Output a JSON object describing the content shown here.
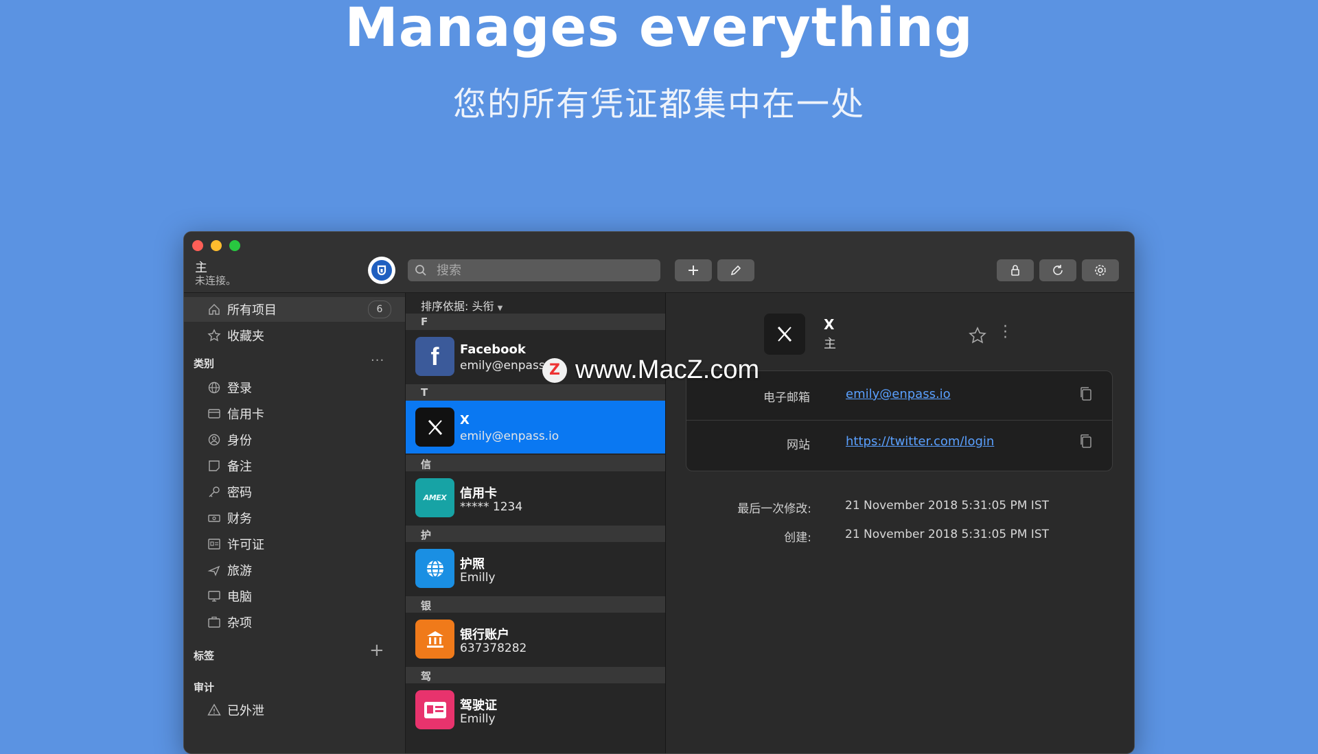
{
  "hero": {
    "title": "Manages everything",
    "subtitle": "您的所有凭证都集中在一处"
  },
  "titlebar": {
    "vault_name": "主",
    "vault_status": "未连接。",
    "search_placeholder": "搜索"
  },
  "sidebar": {
    "top": [
      {
        "label": "所有项目",
        "count": "6",
        "icon": "home-icon"
      },
      {
        "label": "收藏夹",
        "icon": "star-icon"
      }
    ],
    "categories_header": "类别",
    "categories_more": "···",
    "categories": [
      {
        "label": "登录",
        "icon": "globe-icon"
      },
      {
        "label": "信用卡",
        "icon": "credit-card-icon"
      },
      {
        "label": "身份",
        "icon": "person-icon"
      },
      {
        "label": "备注",
        "icon": "note-icon"
      },
      {
        "label": "密码",
        "icon": "key-icon"
      },
      {
        "label": "财务",
        "icon": "finance-icon"
      },
      {
        "label": "许可证",
        "icon": "license-icon"
      },
      {
        "label": "旅游",
        "icon": "plane-icon"
      },
      {
        "label": "电脑",
        "icon": "computer-icon"
      },
      {
        "label": "杂项",
        "icon": "misc-icon"
      }
    ],
    "tags_header": "标签",
    "tags_add": "+",
    "audit_header": "审计",
    "audit": [
      {
        "label": "已外泄",
        "icon": "warning-icon"
      }
    ]
  },
  "list": {
    "sort_label": "排序依据: 头衔",
    "sections": [
      {
        "letter": "F",
        "items": [
          {
            "title": "Facebook",
            "subtitle": "emily@enpass.io",
            "icon": "facebook-icon",
            "color": "#3b5a9a"
          }
        ]
      },
      {
        "letter": "T",
        "items": [
          {
            "title": "X",
            "subtitle": "emily@enpass.io",
            "icon": "x-icon",
            "color": "#111111",
            "selected": true
          }
        ]
      },
      {
        "letter": "信",
        "items": [
          {
            "title": "信用卡",
            "subtitle": "***** 1234",
            "icon": "amex-icon",
            "color": "#17a3a5"
          }
        ]
      },
      {
        "letter": "护",
        "items": [
          {
            "title": "护照",
            "subtitle": "Emilly",
            "icon": "globe-icon",
            "color": "#1a8fe3"
          }
        ]
      },
      {
        "letter": "银",
        "items": [
          {
            "title": "银行账户",
            "subtitle": "637378282",
            "icon": "bank-icon",
            "color": "#f07a1a"
          }
        ]
      },
      {
        "letter": "驾",
        "items": [
          {
            "title": "驾驶证",
            "subtitle": "Emilly",
            "icon": "license-card-icon",
            "color": "#e8336d"
          }
        ]
      }
    ]
  },
  "detail": {
    "title": "X",
    "vault": "主",
    "fields": [
      {
        "label": "电子邮箱",
        "value": "emily@enpass.io"
      },
      {
        "label": "网站",
        "value": "https://twitter.com/login"
      }
    ],
    "meta": [
      {
        "label": "最后一次修改:",
        "value": "21 November 2018 5:31:05 PM IST"
      },
      {
        "label": "创建:",
        "value": "21 November 2018 5:31:05 PM IST"
      }
    ]
  },
  "watermark": {
    "logo_letter": "Z",
    "text": "www.MacZ.com"
  },
  "colors": {
    "background": "#5b93e2",
    "selection": "#0a78f2",
    "link": "#5aa0ff"
  }
}
